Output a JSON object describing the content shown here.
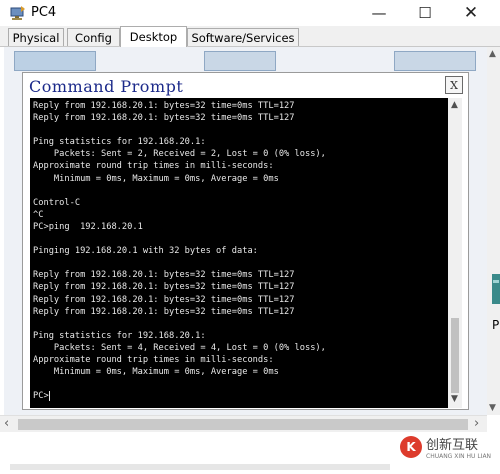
{
  "window": {
    "title": "PC4",
    "controls": {
      "minimize": "—",
      "maximize": "☐",
      "close": "✕"
    }
  },
  "tabs": [
    {
      "label": "Physical",
      "active": false
    },
    {
      "label": "Config",
      "active": false
    },
    {
      "label": "Desktop",
      "active": true
    },
    {
      "label": "Software/Services",
      "active": false
    }
  ],
  "command_prompt": {
    "title": "Command Prompt",
    "close_label": "X",
    "lines": [
      "Reply from 192.168.20.1: bytes=32 time=0ms TTL=127",
      "Reply from 192.168.20.1: bytes=32 time=0ms TTL=127",
      "",
      "Ping statistics for 192.168.20.1:",
      "    Packets: Sent = 2, Received = 2, Lost = 0 (0% loss),",
      "Approximate round trip times in milli-seconds:",
      "    Minimum = 0ms, Maximum = 0ms, Average = 0ms",
      "",
      "Control-C",
      "^C",
      "PC>ping  192.168.20.1",
      "",
      "Pinging 192.168.20.1 with 32 bytes of data:",
      "",
      "Reply from 192.168.20.1: bytes=32 time=0ms TTL=127",
      "Reply from 192.168.20.1: bytes=32 time=0ms TTL=127",
      "Reply from 192.168.20.1: bytes=32 time=0ms TTL=127",
      "Reply from 192.168.20.1: bytes=32 time=0ms TTL=127",
      "",
      "Ping statistics for 192.168.20.1:",
      "    Packets: Sent = 4, Received = 4, Lost = 0 (0% loss),",
      "Approximate round trip times in milli-seconds:",
      "    Minimum = 0ms, Maximum = 0ms, Average = 0ms",
      "",
      "PC>"
    ]
  },
  "side": {
    "label": "P"
  },
  "watermark": {
    "logo": "K",
    "text": "创新互联",
    "sub": "CHUANG XIN HU LIAN"
  },
  "colors": {
    "terminal_bg": "#000000",
    "terminal_fg": "#e8e8e8",
    "cmd_title": "#1c2a8a"
  }
}
